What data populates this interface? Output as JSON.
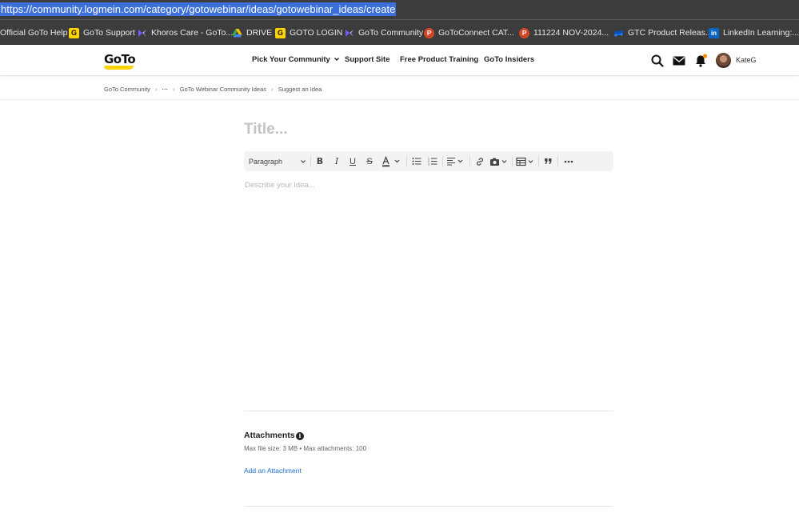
{
  "browser": {
    "url": "https://community.logmein.com/category/gotowebinar/ideas/gotowebinar_ideas/create",
    "bookmarks": [
      {
        "label": "Official GoTo Help",
        "icon": "none"
      },
      {
        "label": "GoTo Support",
        "icon": "goto-g-icon"
      },
      {
        "label": "Khoros Care - GoTo...",
        "icon": "khoros-icon"
      },
      {
        "label": "DRIVE",
        "icon": "google-drive-icon"
      },
      {
        "label": "GOTO LOGIN",
        "icon": "goto-g-icon"
      },
      {
        "label": "GoTo Community",
        "icon": "khoros-icon"
      },
      {
        "label": "GoToConnect CAT...",
        "icon": "powerpoint-icon"
      },
      {
        "label": "111224 NOV-2024...",
        "icon": "powerpoint-icon"
      },
      {
        "label": "GTC Product Releas...",
        "icon": "confluence-icon"
      },
      {
        "label": "LinkedIn Learning:...",
        "icon": "linkedin-icon"
      }
    ]
  },
  "header": {
    "logo": "GoTo",
    "nav": [
      "Pick Your Community",
      "Support Site",
      "Free Product Training",
      "GoTo Insiders"
    ],
    "username": "KateG",
    "brand_color": "#ffd400",
    "notification_dot_color": "#ff8a00"
  },
  "breadcrumb": [
    "GoTo Community",
    "···",
    "GoTo Webinar Community Ideas",
    "Suggest an Idea"
  ],
  "editor": {
    "title_placeholder": "Title...",
    "paragraph_style": "Paragraph",
    "body_placeholder": "Describe your Idea..."
  },
  "attachments": {
    "title": "Attachments",
    "limits": "Max file size: 3 MB • Max attachments: 100",
    "add_link": "Add an Attachment",
    "link_color": "#1f6fd1"
  }
}
